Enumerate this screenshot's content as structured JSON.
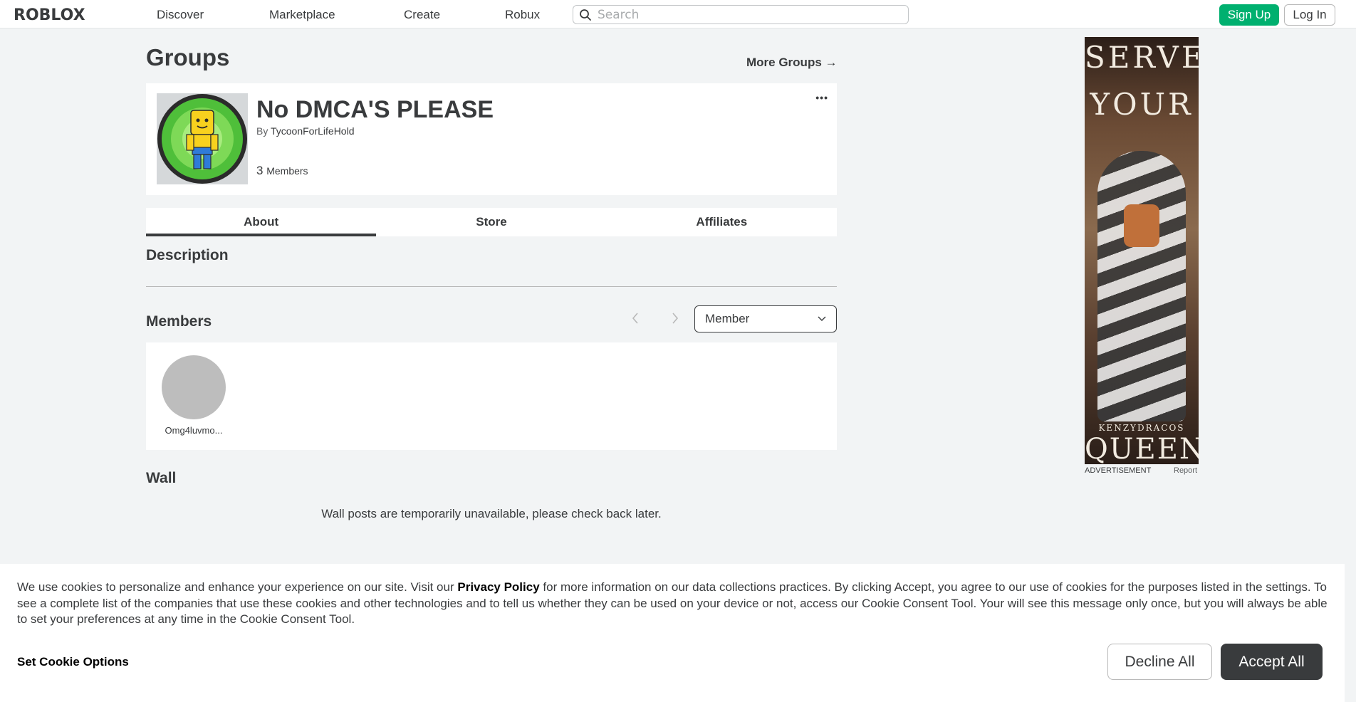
{
  "nav": {
    "logo": "ROBLOX",
    "links": [
      "Discover",
      "Marketplace",
      "Create",
      "Robux"
    ],
    "search_placeholder": "Search",
    "signup_label": "Sign Up",
    "login_label": "Log In"
  },
  "page": {
    "title": "Groups",
    "more_groups": "More Groups →"
  },
  "group": {
    "name": "No DMCA'S PLEASE",
    "by_label": "By",
    "owner": "TycoonForLifeHold",
    "member_count": "3",
    "members_label": "Members",
    "more_label": "•••"
  },
  "tabs": [
    "About",
    "Store",
    "Affiliates"
  ],
  "sections": {
    "description": "Description",
    "members": "Members",
    "wall": "Wall"
  },
  "members_panel": {
    "role_selected": "Member",
    "list": [
      {
        "name": "Omg4luvmo..."
      }
    ]
  },
  "wall": {
    "message": "Wall posts are temporarily unavailable, please check back later."
  },
  "ad": {
    "line1": "SERVE",
    "line2": "YOUR",
    "brand": "KENZYDRACOS",
    "line3": "QUEEN",
    "label": "ADVERTISEMENT",
    "report": "Report"
  },
  "cookie": {
    "text_before": "We use cookies to personalize and enhance your experience on our site. Visit our ",
    "privacy_link": "Privacy Policy",
    "text_after": " for more information on our data collections practices. By clicking Accept, you agree to our use of cookies for the purposes listed in the settings. To see a complete list of the companies that use these cookies and other technologies and to tell us whether they can be used on your device or not, access our Cookie Consent Tool. Your will see this message only once, but you will always be able to set your preferences at any time in the Cookie Consent Tool.",
    "options_label": "Set Cookie Options",
    "decline_label": "Decline All",
    "accept_label": "Accept All"
  },
  "colors": {
    "accent_green": "#00b06f",
    "text_dark": "#393b3d",
    "page_bg": "#f2f4f5"
  }
}
